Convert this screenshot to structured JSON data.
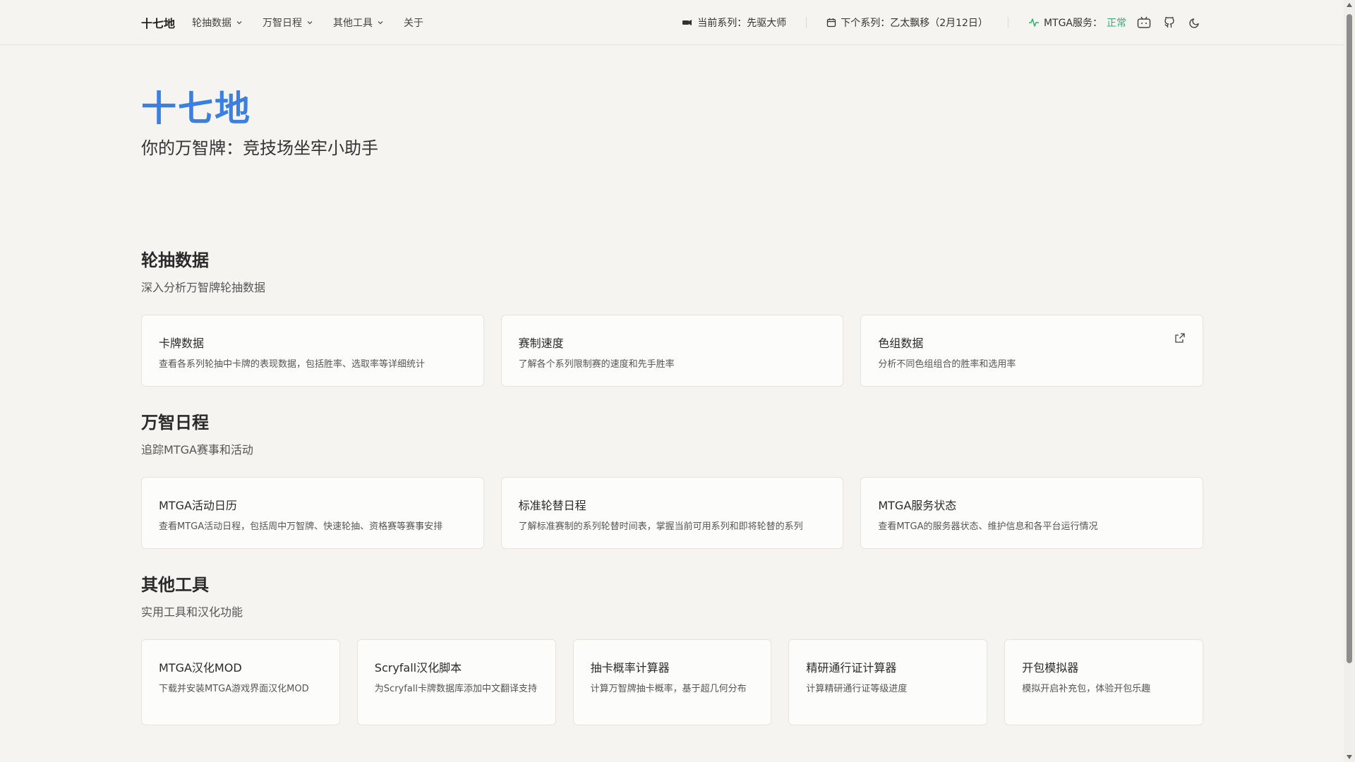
{
  "header": {
    "brand": "十七地",
    "nav": [
      {
        "label": "轮抽数据",
        "dropdown": true
      },
      {
        "label": "万智日程",
        "dropdown": true
      },
      {
        "label": "其他工具",
        "dropdown": true
      },
      {
        "label": "关于",
        "dropdown": false
      }
    ],
    "current_set_label": "当前系列：先驱大师",
    "next_set_label": "下个系列：乙太飘移（2月12日）",
    "service_label": "MTGA服务：",
    "service_status": "正常",
    "icons": [
      "mana-icon",
      "calendar-icon",
      "activity-icon",
      "bilibili-icon",
      "github-icon",
      "moon-icon"
    ]
  },
  "hero": {
    "title": "十七地",
    "subtitle": "你的万智牌：竞技场坐牢小助手"
  },
  "sections": [
    {
      "title": "轮抽数据",
      "subtitle": "深入分析万智牌轮抽数据",
      "cards": [
        {
          "title": "卡牌数据",
          "desc": "查看各系列轮抽中卡牌的表现数据，包括胜率、选取率等详细统计"
        },
        {
          "title": "赛制速度",
          "desc": "了解各个系列限制赛的速度和先手胜率"
        },
        {
          "title": "色组数据",
          "desc": "分析不同色组组合的胜率和选用率",
          "external": true
        }
      ]
    },
    {
      "title": "万智日程",
      "subtitle": "追踪MTGA赛事和活动",
      "cards": [
        {
          "title": "MTGA活动日历",
          "desc": "查看MTGA活动日程，包括周中万智牌、快速轮抽、资格赛等赛事安排"
        },
        {
          "title": "标准轮替日程",
          "desc": "了解标准赛制的系列轮替时间表，掌握当前可用系列和即将轮替的系列"
        },
        {
          "title": "MTGA服务状态",
          "desc": "查看MTGA的服务器状态、维护信息和各平台运行情况"
        }
      ]
    },
    {
      "title": "其他工具",
      "subtitle": "实用工具和汉化功能",
      "cards": [
        {
          "title": "MTGA汉化MOD",
          "desc": "下载并安装MTGA游戏界面汉化MOD"
        },
        {
          "title": "Scryfall汉化脚本",
          "desc": "为Scryfall卡牌数据库添加中文翻译支持"
        },
        {
          "title": "抽卡概率计算器",
          "desc": "计算万智牌抽卡概率，基于超几何分布"
        },
        {
          "title": "精研通行证计算器",
          "desc": "计算精研通行证等级进度"
        },
        {
          "title": "开包模拟器",
          "desc": "模拟开启补充包，体验开包乐趣"
        }
      ]
    }
  ],
  "colors": {
    "accent": "#3b7fe0",
    "status_ok": "#1fb86e",
    "background": "#f5f4f1"
  }
}
